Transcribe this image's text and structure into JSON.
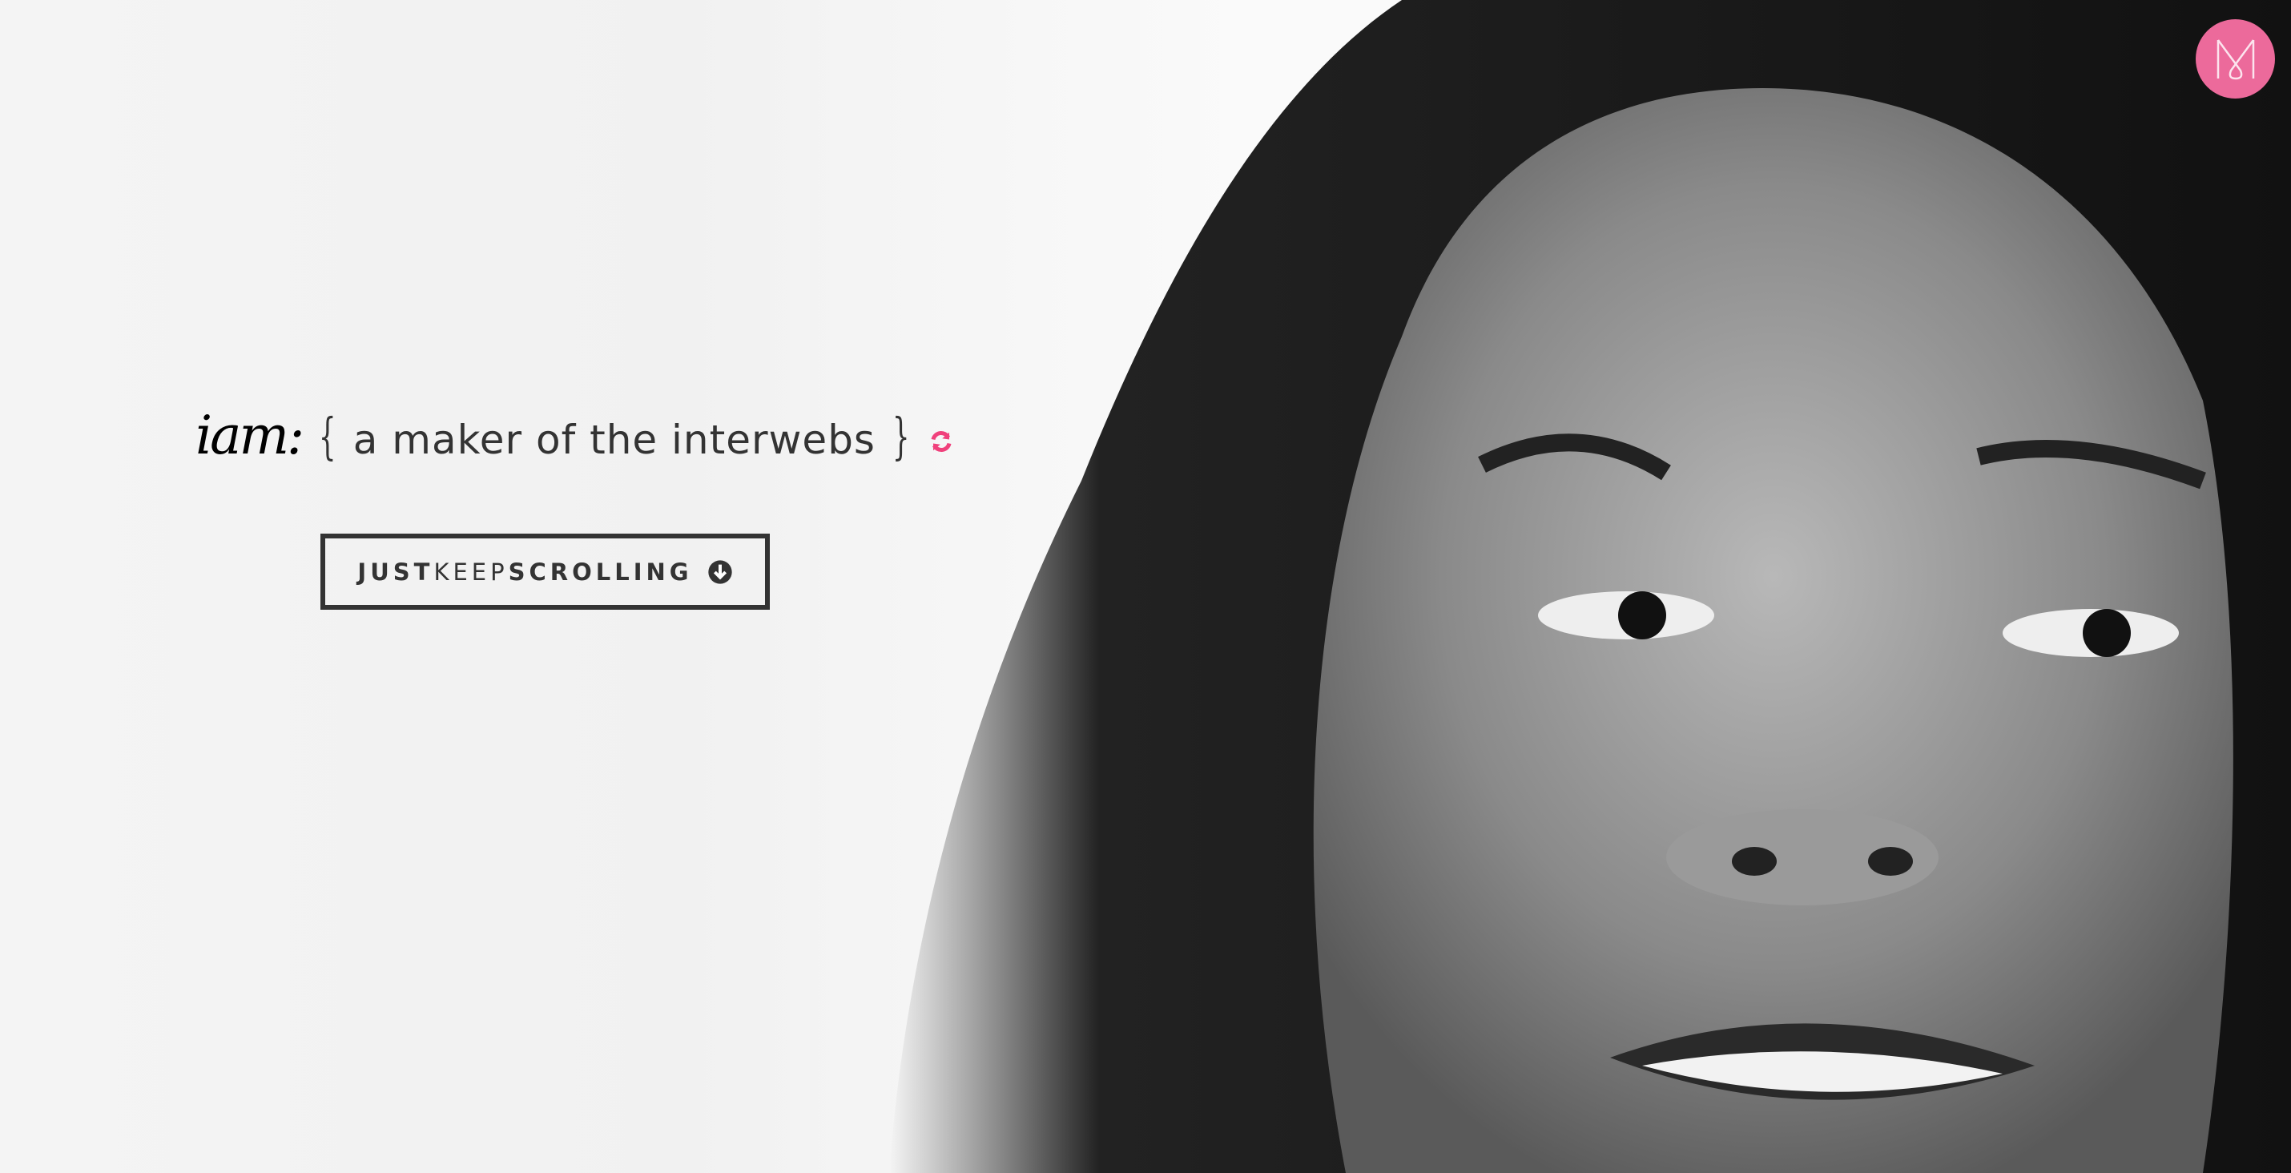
{
  "hero": {
    "prefix": "iam:",
    "open_brace": "{",
    "phrase": "a maker of the interwebs",
    "close_brace": "}",
    "refresh_icon": "refresh-icon"
  },
  "scroll_button": {
    "part1": "JUST",
    "part2": "KEEP",
    "part3": "SCROLLING",
    "icon": "arrow-circle-down-icon"
  },
  "logo": {
    "letter": "M"
  },
  "colors": {
    "accent": "#ec6a9b",
    "text": "#333333",
    "refresh": "#f0417c"
  }
}
